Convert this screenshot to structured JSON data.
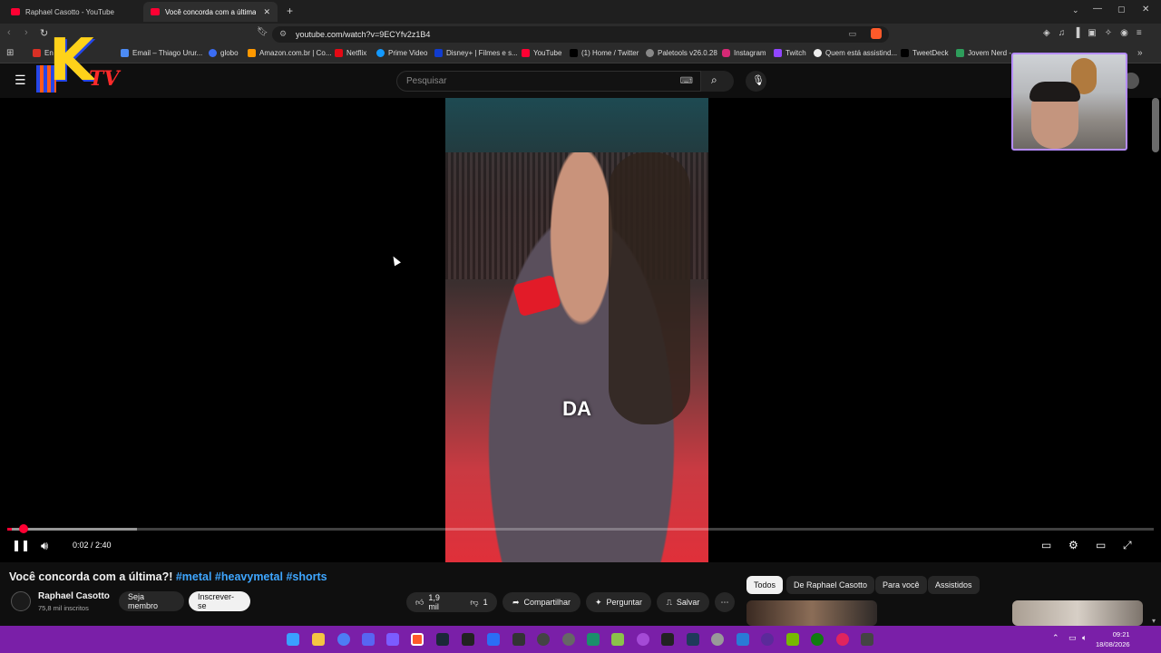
{
  "browser": {
    "tabs": [
      {
        "label": "Raphael Casotto - YouTube"
      },
      {
        "label": "Você concorda com a última?"
      }
    ],
    "new_tab_label": "+",
    "url": "youtube.com/watch?v=9ECYfv2z1B4"
  },
  "bookmarks": [
    {
      "label": "En",
      "icon_color": "#d93025"
    },
    {
      "label": "Email – Thiago Urur...",
      "icon_color": "#4c8bf5"
    },
    {
      "label": "globo",
      "icon_color": "#3b6df5"
    },
    {
      "label": "Amazon.com.br | Co...",
      "icon_color": "#ff9900"
    },
    {
      "label": "Netflix",
      "icon_color": "#e50914"
    },
    {
      "label": "Prime Video",
      "icon_color": "#1399ff"
    },
    {
      "label": "Disney+ | Filmes e s...",
      "icon_color": "#113ccf"
    },
    {
      "label": "YouTube",
      "icon_color": "#ff0033"
    },
    {
      "label": "(1) Home / Twitter",
      "icon_color": "#000000"
    },
    {
      "label": "Paletools v26.0.28",
      "icon_color": "#888888"
    },
    {
      "label": "Instagram",
      "icon_color": "#d62976"
    },
    {
      "label": "Twitch",
      "icon_color": "#9146ff"
    },
    {
      "label": "Quem está assistind...",
      "icon_color": "#eeeeee"
    },
    {
      "label": "TweetDeck",
      "icon_color": "#000000"
    },
    {
      "label": "Jovem Nerd -",
      "icon_color": "#2e9d5b"
    }
  ],
  "youtube": {
    "search_placeholder": "Pesquisar",
    "video": {
      "caption": "DA",
      "time_display": "0:02 / 2:40",
      "progress_fraction": 0.004,
      "buffered_fraction": 0.113
    },
    "title_main": "Você concorda com a última?! ",
    "title_tags": "#metal #heavymetal #shorts",
    "channel": {
      "name": "Raphael Casotto",
      "subscribers": "75,8 mil inscritos",
      "member_label": "Seja membro",
      "subscribe_label": "Inscrever-se"
    },
    "actions": {
      "likes": "1,9 mil",
      "dislikes": "1",
      "share": "Compartilhar",
      "ask": "Perguntar",
      "save": "Salvar",
      "more": "⋯"
    },
    "chips": [
      "Todos",
      "De Raphael Casotto",
      "Para você",
      "Assistidos"
    ]
  },
  "overlay": {
    "logo_k": "K",
    "logo_tv": "TV"
  },
  "taskbar": {
    "time": "09:21",
    "date": "18/08/2026"
  },
  "colors": {
    "accent_red": "#ff0033",
    "link_blue": "#3ea6ff",
    "taskbar_purple": "#7a1fa8",
    "webcam_border": "#b58cff"
  }
}
